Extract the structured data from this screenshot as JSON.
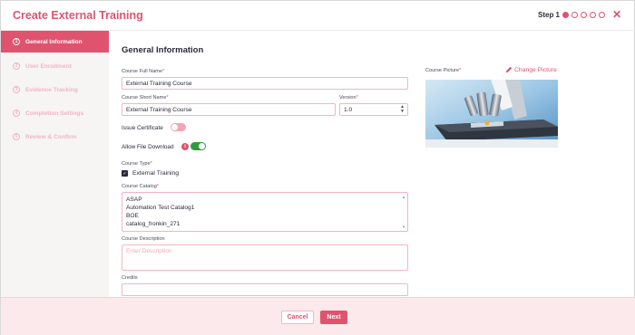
{
  "header": {
    "title": "Create External Training",
    "step_label": "Step 1",
    "step_dots": 5,
    "active_step": 1,
    "close_icon": "close-icon"
  },
  "sidebar": {
    "items": [
      {
        "num": "1",
        "label": "General Information",
        "active": true
      },
      {
        "num": "2",
        "label": "User Enrollment",
        "active": false
      },
      {
        "num": "3",
        "label": "Evidence Tracking",
        "active": false
      },
      {
        "num": "4",
        "label": "Completion Settings",
        "active": false
      },
      {
        "num": "5",
        "label": "Review & Confirm",
        "active": false
      }
    ]
  },
  "form": {
    "section_title": "General Information",
    "full_name_label": "Course Full Name",
    "full_name_value": "External Training Course",
    "short_name_label": "Course Short Name",
    "short_name_value": "External Training Course",
    "version_label": "Version",
    "version_value": "1.0",
    "issue_certificate_label": "Issue Certificate",
    "issue_certificate_on": false,
    "allow_download_label": "Allow File Download",
    "allow_download_on": true,
    "info_icon": "i",
    "course_type_label": "Course Type",
    "course_type_value": "External Training",
    "catalog_label": "Course Catalog",
    "catalog_options": [
      "ASAP",
      "Automation Test Catalog1",
      "BOE",
      "catalog_fronkin_271"
    ],
    "description_label": "Course Description",
    "description_placeholder": "Enter Description",
    "credits_label": "Credits",
    "credits_value": "",
    "required_mark": "*"
  },
  "picture": {
    "label": "Course Picture",
    "change_label": "Change Picture",
    "icon": "pencil-icon"
  },
  "footer": {
    "cancel_label": "Cancel",
    "next_label": "Next"
  },
  "colors": {
    "accent": "#e0536e",
    "toggle_on": "#2f9c3b"
  }
}
